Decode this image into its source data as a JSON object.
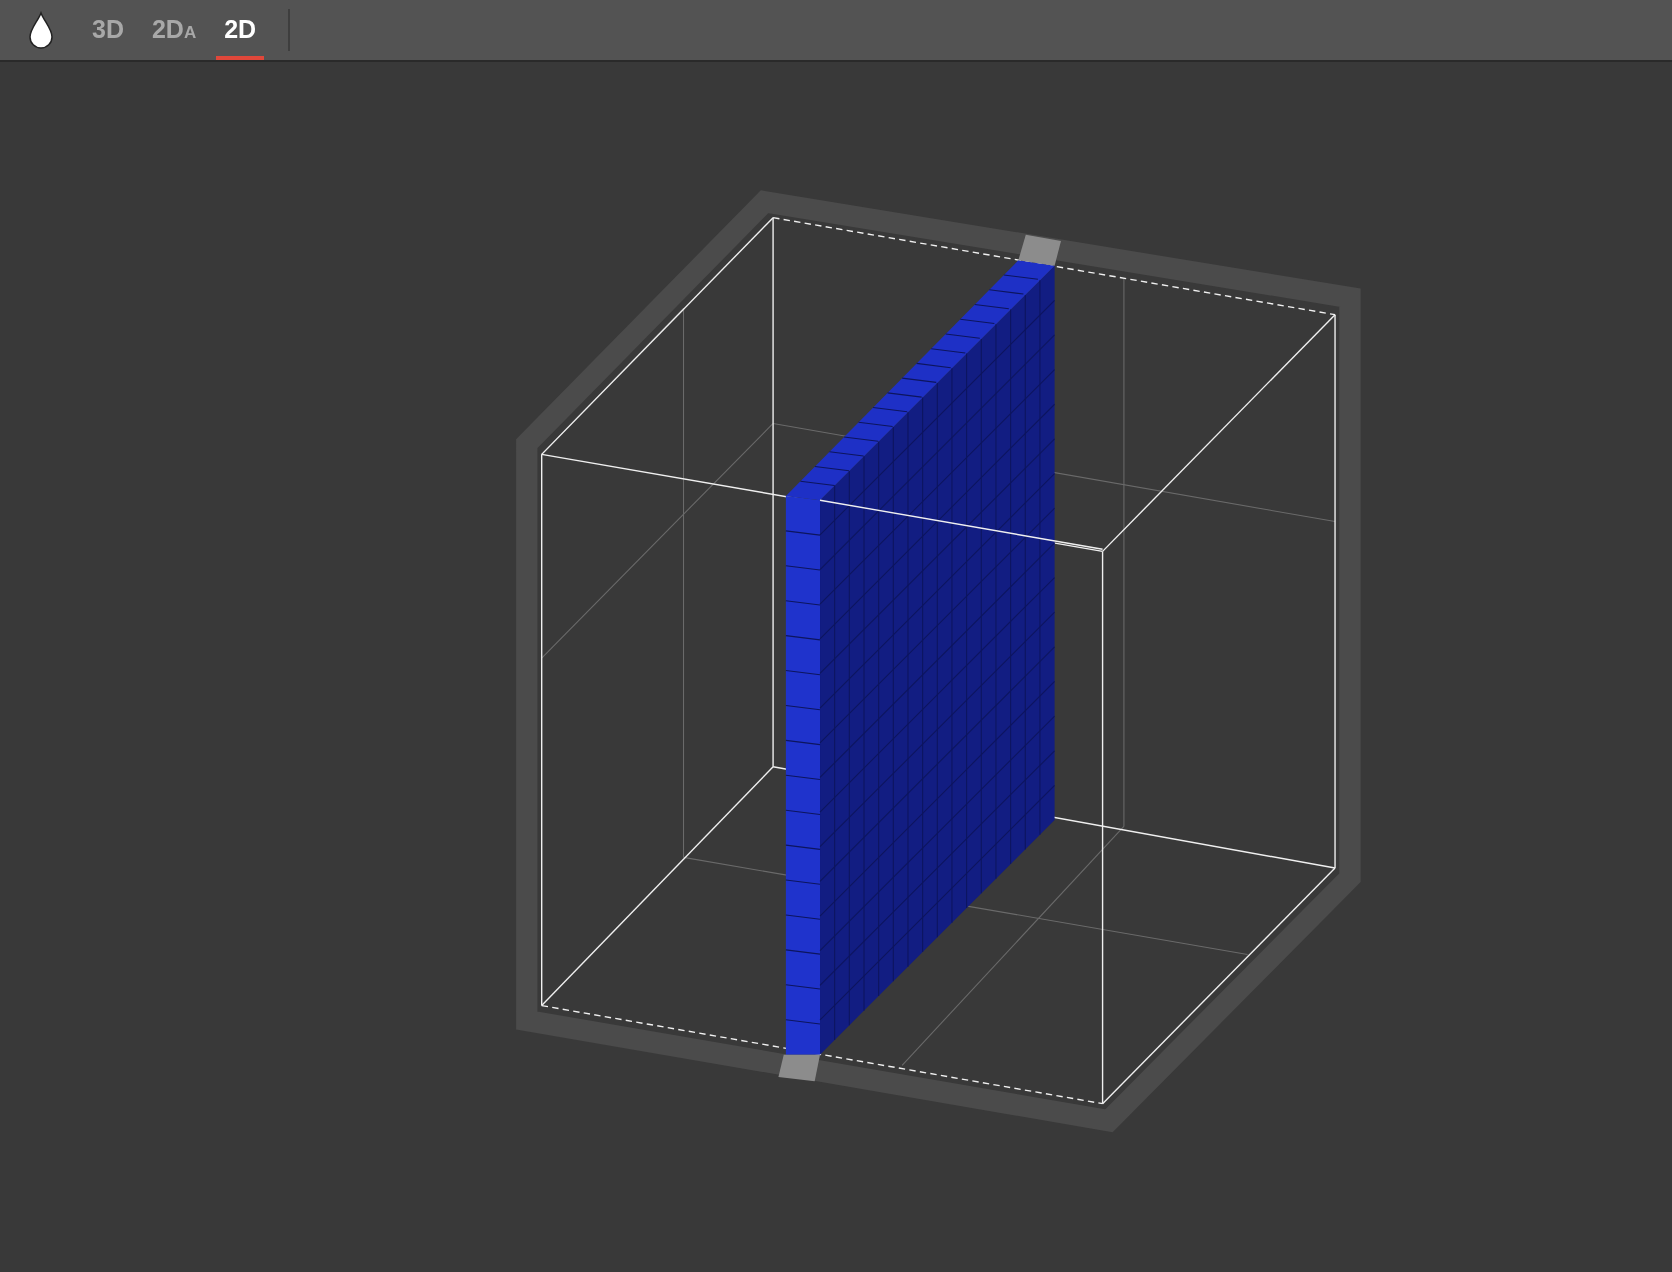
{
  "toolbar": {
    "tabs": [
      {
        "label": "3D",
        "selected": false
      },
      {
        "label": "2D",
        "suffix": "A",
        "selected": false
      },
      {
        "label": "2D",
        "selected": true
      }
    ]
  }
}
